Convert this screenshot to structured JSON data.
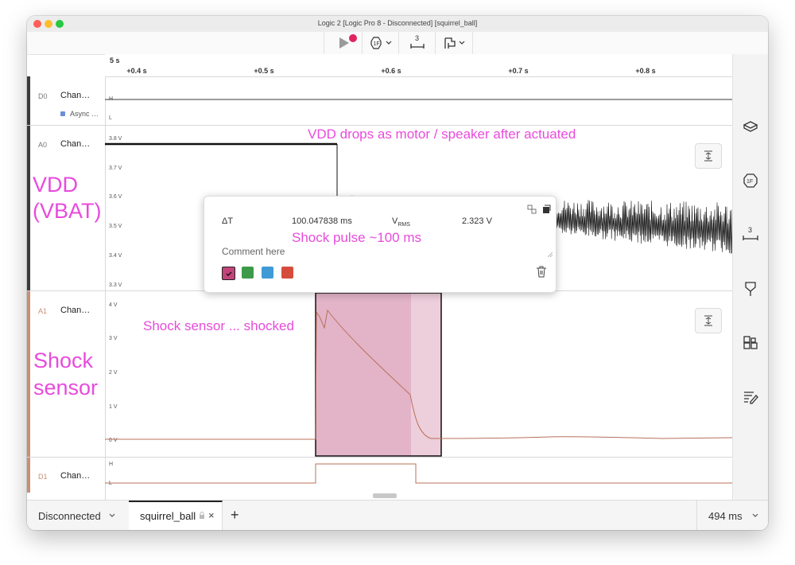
{
  "window": {
    "title": "Logic 2 [Logic Pro 8 - Disconnected] [squirrel_ball]",
    "traffic_colors": [
      "#ff5f57",
      "#febc2e",
      "#28c840"
    ]
  },
  "toolbar": {
    "play_icon": "play-icon",
    "record_dot_color": "#e0245e",
    "trigger_icon": "trigger-icon",
    "measure_value": "3",
    "layout_icon": "layout-icon"
  },
  "ruler": {
    "start": "5 s",
    "ticks": [
      "+0.4 s",
      "+0.5 s",
      "+0.6 s",
      "+0.7 s",
      "+0.8 s"
    ]
  },
  "channels": {
    "d0": {
      "id": "D0",
      "name": "Chan…",
      "analyzer": "Async …",
      "analyzer_color": "#6c8fd6",
      "hi": "H",
      "lo": "L",
      "color": "#3a3a3a"
    },
    "a0": {
      "id": "A0",
      "name": "Chan…",
      "color": "#3a3a3a",
      "ylabels": [
        "3.8 V",
        "3.7 V",
        "3.6 V",
        "3.5 V",
        "3.4 V",
        "3.3 V"
      ]
    },
    "a1": {
      "id": "A1",
      "name": "Chan…",
      "color": "#c88e74",
      "ylabels": [
        "4 V",
        "3 V",
        "2 V",
        "1 V",
        "0 V"
      ]
    },
    "d1": {
      "id": "D1",
      "name": "Chan…",
      "color": "#c88e74",
      "hi": "H",
      "lo": "L"
    }
  },
  "annotations": {
    "vdd": "VDD\n(VBAT)",
    "vdd_drop": "VDD drops as motor / speaker after actuated",
    "shock_pulse": "Shock pulse ~100 ms",
    "shock_sensor_shocked": "Shock sensor ... shocked",
    "shock_sensor": "Shock\nsensor",
    "color": "#e84bdc"
  },
  "measurement": {
    "dt_label": "ΔT",
    "dt_value": "100.047838 ms",
    "vrms_label": "V",
    "vrms_sub": "RMS",
    "vrms_value": "2.323 V",
    "comment_placeholder": "Comment here",
    "swatches": [
      "#c2447a",
      "#3c9a4a",
      "#3f9bd6",
      "#d64c3c"
    ],
    "selection_color": "#d99bb6"
  },
  "bottom": {
    "device": "Disconnected",
    "tab": "squirrel_ball",
    "add": "+",
    "close": "×",
    "time": "494 ms"
  }
}
